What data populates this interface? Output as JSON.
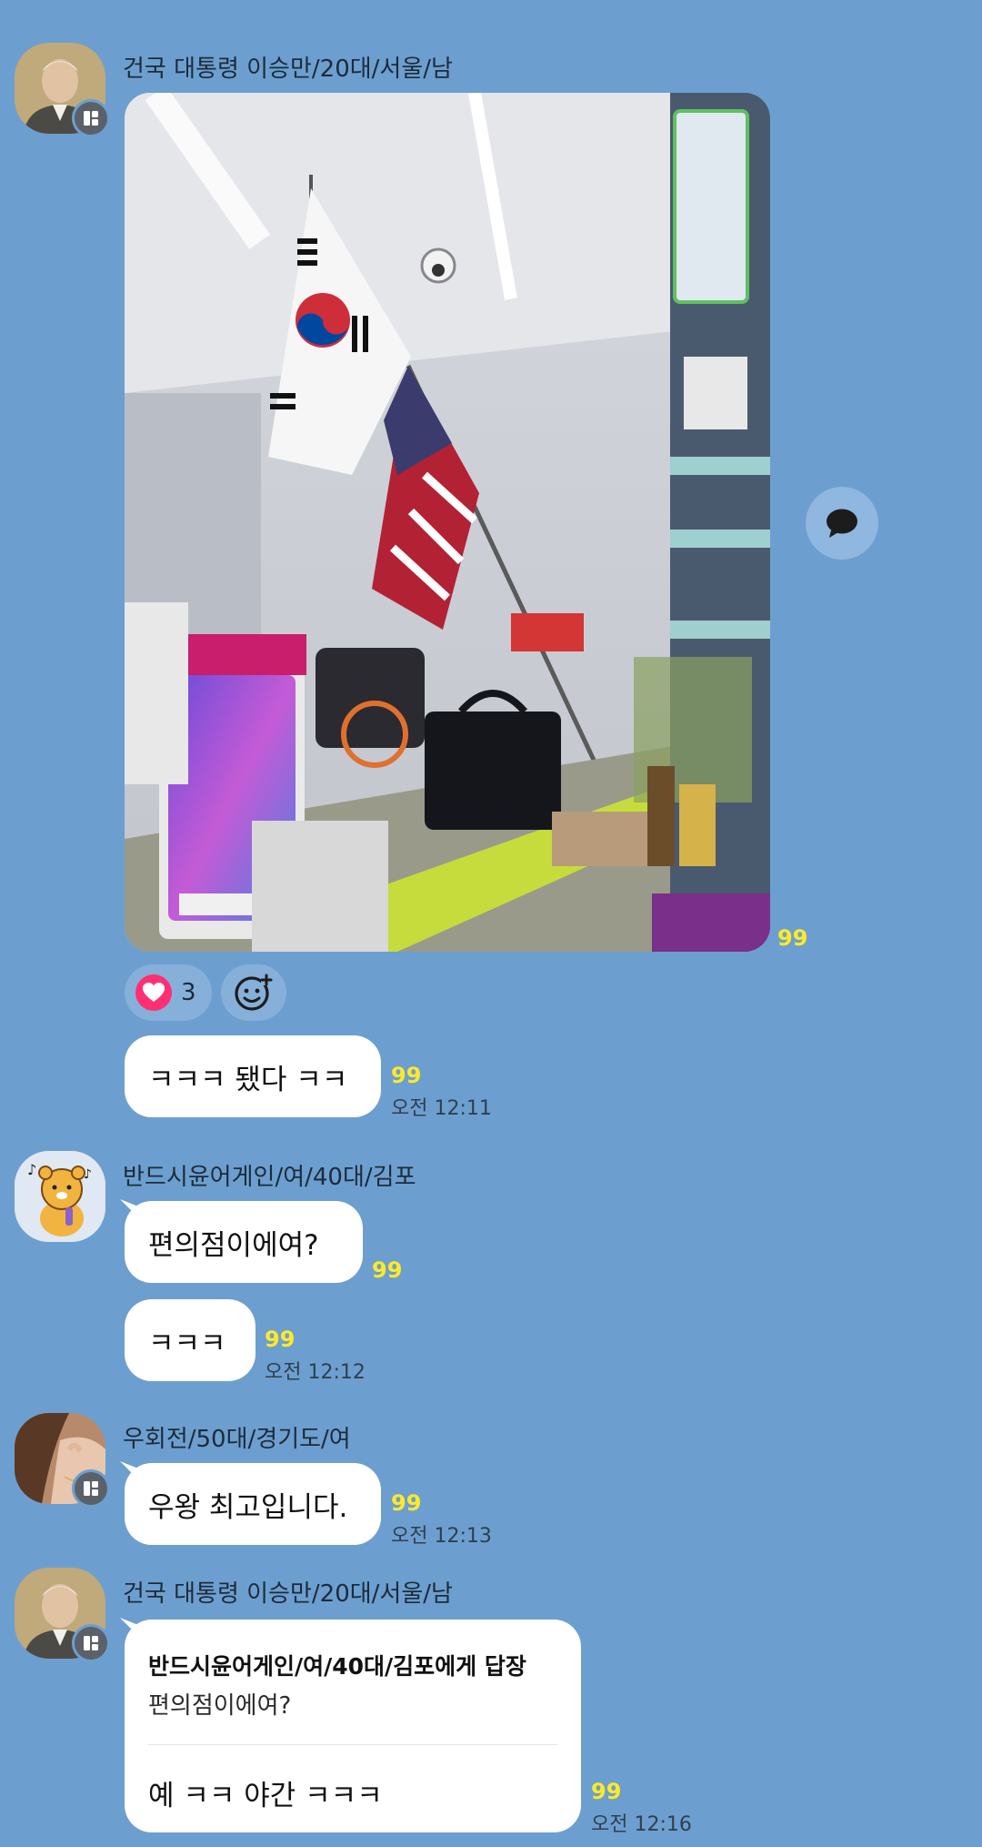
{
  "messages": {
    "m1": {
      "sender": "건국 대통령 이승만/20대/서울/남",
      "unread": "99"
    },
    "reactions": {
      "like_count": "3"
    },
    "m2": {
      "text": "ㅋㅋㅋ 됐다 ㅋㅋ",
      "unread": "99",
      "time": "오전 12:11"
    },
    "m3": {
      "sender": "반드시윤어게인/여/40대/김포",
      "text": "편의점이에여?",
      "unread": "99"
    },
    "m4": {
      "text": "ㅋㅋㅋ",
      "unread": "99",
      "time": "오전 12:12"
    },
    "m5": {
      "sender": "우회전/50대/경기도/여",
      "text": "우왕 최고입니다.",
      "unread": "99",
      "time": "오전 12:13"
    },
    "m6": {
      "sender": "건국 대통령 이승만/20대/서울/남",
      "reply_to": "반드시윤어게인/여/40대/김포에게 답장",
      "quoted": "편의점이에여?",
      "text": "예 ㅋㅋ 야간 ㅋㅋㅋ",
      "unread": "99",
      "time": "오전 12:16"
    }
  },
  "colors": {
    "background": "#6c9fcf",
    "unread": "#ffe92a",
    "heart": "#ff2f74"
  },
  "icons": [
    "board-icon",
    "speech-bubble-icon",
    "heart-icon",
    "smiley-add-icon"
  ]
}
